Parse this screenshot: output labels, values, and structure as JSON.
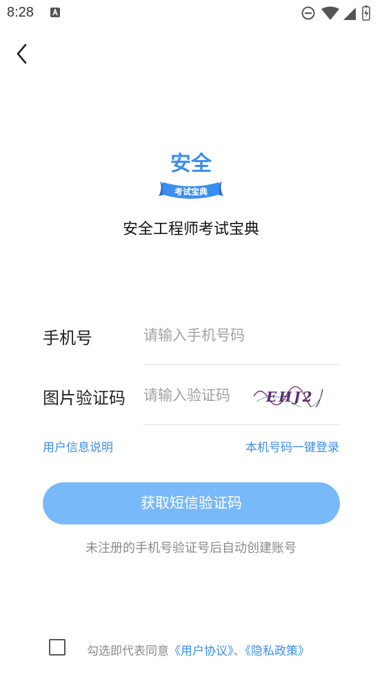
{
  "status_bar": {
    "time": "8:28",
    "notification_icon": "app-notification-icon",
    "icons": [
      "do-not-disturb-icon",
      "wifi-icon",
      "signal-icon",
      "battery-icon"
    ]
  },
  "nav": {
    "back_icon": "chevron-left-icon"
  },
  "logo": {
    "title": "安全",
    "ribbon": "考试宝典"
  },
  "app_name": "安全工程师考试宝典",
  "form": {
    "phone_label": "手机号",
    "phone_placeholder": "请输入手机号码",
    "captcha_label": "图片验证码",
    "captcha_placeholder": "请输入验证码",
    "captcha_text": "EHJ2"
  },
  "links": {
    "user_info": "用户信息说明",
    "one_click_login": "本机号码一键登录"
  },
  "primary_button": "获取短信验证码",
  "hint": "未注册的手机号验证号后自动创建账号",
  "agreement": {
    "checked": false,
    "prefix": "勾选即代表同意",
    "user_agreement": "《用户协议》",
    "separator": "、",
    "privacy_policy": "《隐私政策》"
  },
  "colors": {
    "accent": "#3a8ef0",
    "button": "#78b9f9",
    "placeholder": "#a3a3a3",
    "hint": "#8a8a8a"
  }
}
